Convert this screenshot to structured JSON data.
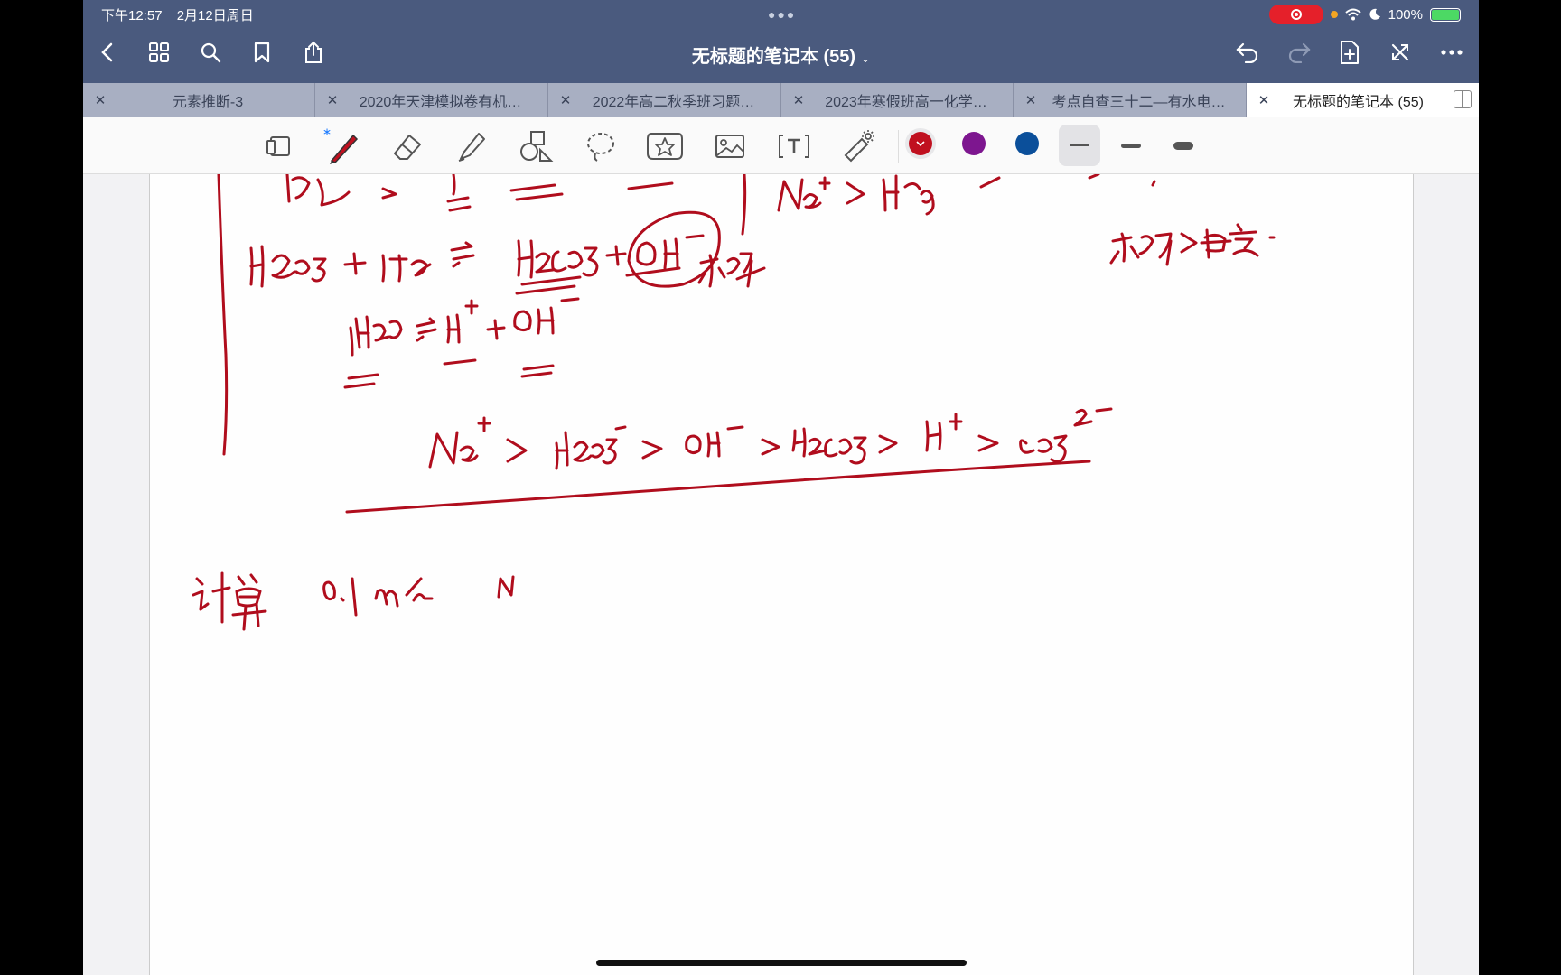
{
  "status_bar": {
    "time": "下午12:57",
    "date": "2月12日周日",
    "battery_percent": "100%"
  },
  "nav": {
    "title": "无标题的笔记本 (55)",
    "title_chevron": "⌄"
  },
  "tabs": [
    {
      "label": "元素推断-3",
      "active": false
    },
    {
      "label": "2020年天津模拟卷有机…",
      "active": false
    },
    {
      "label": "2022年高二秋季班习题…",
      "active": false
    },
    {
      "label": "2023年寒假班高一化学…",
      "active": false
    },
    {
      "label": "考点自查三十二—有水电…",
      "active": false
    },
    {
      "label": "无标题的笔记本 (55)",
      "active": true
    }
  ],
  "toolbar": {
    "tools": [
      "page-settings-icon",
      "pen-icon",
      "eraser-icon",
      "highlighter-icon",
      "shapes-icon",
      "lasso-icon",
      "sticker-icon",
      "image-icon",
      "text-icon",
      "laser-pointer-icon"
    ],
    "colors": [
      "#c0101f",
      "#7d168f",
      "#0b4f9a"
    ],
    "selected_color": "#c0101f",
    "selected_width_index": 0
  },
  "colors": {
    "topbar": "#4a5a7e",
    "ink": "#b00d1d"
  }
}
